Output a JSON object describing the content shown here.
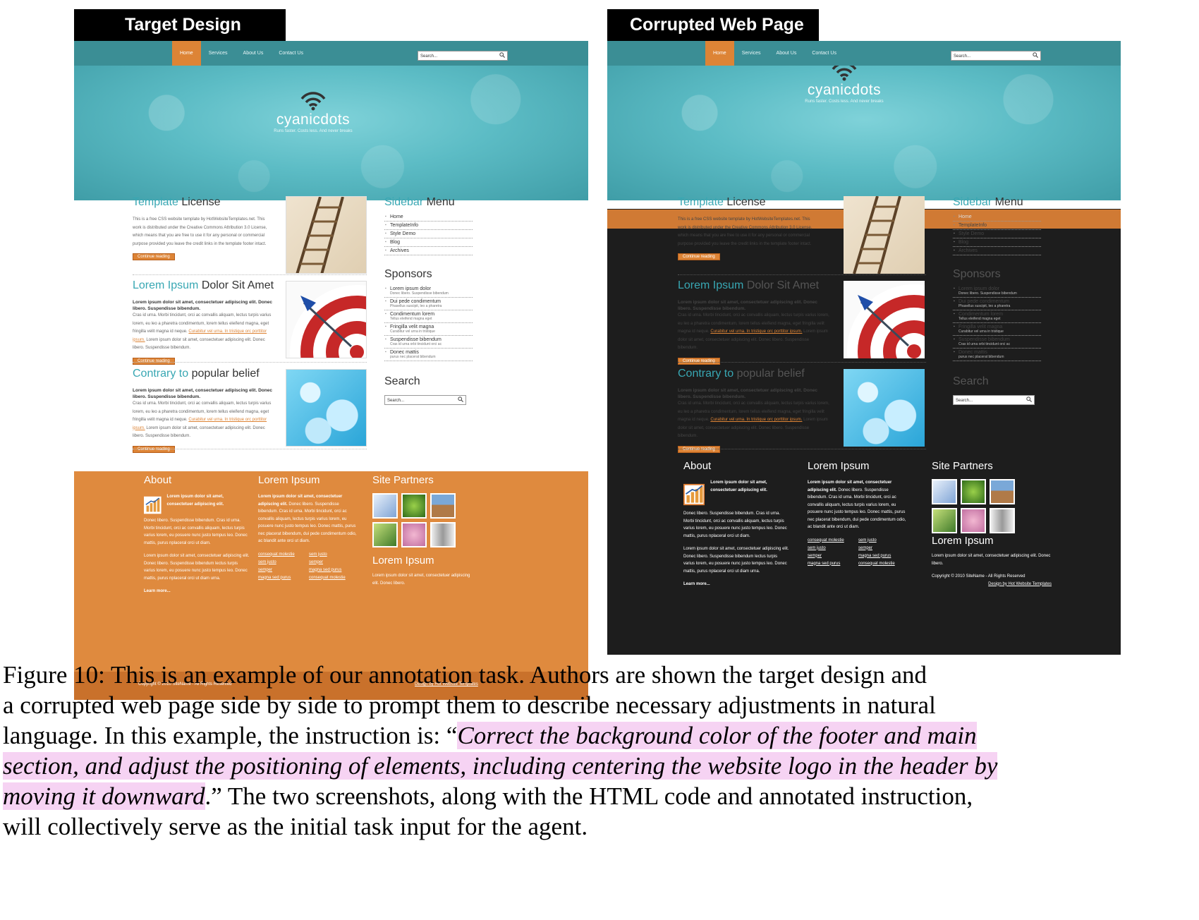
{
  "labels": {
    "left": "Target Design",
    "right": "Corrupted Web Page"
  },
  "site": {
    "nav": [
      "Home",
      "Services",
      "About Us",
      "Contact Us"
    ],
    "search_placeholder": "Search...",
    "logo_light": "cyanic",
    "logo_bold": "dots",
    "tagline": "Runs faster. Costs less. And never breaks",
    "articles": [
      {
        "accent": "Template",
        "rest": " License",
        "body": "This is a free CSS website template by HotWebsiteTemplates.net. This work is distributed under the Creative Commons Attribution 3.0 License, which means that you are free to use it for any personal or commercial purpose provided you leave the credit links in the template footer intact.",
        "button": "Continue reading"
      },
      {
        "accent": "Lorem Ipsum",
        "rest": " Dolor Sit Amet",
        "bold": "Lorem ipsum dolor sit amet, consectetuer adipiscing elit. Donec libero. Suspendisse bibendum.",
        "body": "Cras id urna. Morbi tincidunt, orci ac convallis aliquam, lectus turpis varius lorem, eu leo a pharetra condimentum, lorem tellus eleifend magna, eget fringilla velit magna id neque.",
        "link": "Curabitur vel urna. In tristique orc porttitor ipsum.",
        "body2": "Lorem ipsum dolor sit amet, consectetuer adipiscing elit. Donec libero. Suspendisse bibendum.",
        "button": "Continue reading"
      },
      {
        "accent": "Contrary to",
        "rest": " popular belief",
        "bold": "Lorem ipsum dolor sit amet, consectetuer adipiscing elit. Donec libero. Suspendisse bibendum.",
        "body": "Cras id urna. Morbi tincidunt, orci ac convallis aliquam, lectus turpis varius lorem, eu leo a pharetra condimentum, lorem tellus eleifend magna, eget fringilla velit magna id neque.",
        "link": "Curabitur vel urna. In tristique orc porttitor ipsum.",
        "body2": "Lorem ipsum dolor sit amet, consectetuer adipiscing elit. Donec libero. Suspendisse bibendum.",
        "button": "Continue reading"
      }
    ],
    "sidebar": {
      "menu_accent": "Sidebar",
      "menu_rest": " Menu",
      "menu_items": [
        "Home",
        "TemplateInfo",
        "Style Demo",
        "Blog",
        "Archives"
      ],
      "sponsors_title": "Sponsors",
      "sponsors": [
        {
          "name": "Lorem ipsum dolor",
          "sub": "Donec libero. Suspendisse bibendum"
        },
        {
          "name": "Dui pede condimentum",
          "sub": "Phasellus suscipit, leo a pharetra"
        },
        {
          "name": "Condimentum lorem",
          "sub": "Tellus eleifend magna eget"
        },
        {
          "name": "Fringilla velit magna",
          "sub": "Curabitur vel urna in tristique"
        },
        {
          "name": "Suspendisse bibendum",
          "sub": "Cras id urna orbi tincidunt orci ac"
        },
        {
          "name": "Donec mattis",
          "sub": "purus nec placerat bibendum"
        }
      ],
      "search_title": "Search"
    },
    "footer": {
      "about_title": "About",
      "about_bold": "Lorem ipsum dolor sit amet, consectetuer adipiscing elit.",
      "about_body": "Donec libero. Suspendisse bibendum. Cras id urna. Morbi tincidunt, orci ac convallis aliquam, lectus turpis varius lorem, eu posuere nunc justo tempus leo. Donec mattis, purus nplaceral orci ut diam.",
      "about_body2": "Lorem ipsum dolor sit amet, consectetuer adipiscing elit. Donec libero. Suspendisse bibendum lectus turpis varius lorem, eu posuere nunc justo tempus leo. Donec mattis, purus nplaceral orci ut diam urna.",
      "learn_more": "Learn more...",
      "lorem_title": "Lorem Ipsum",
      "lorem_bold": "Lorem ipsum dolor sit amet, consectetuer adipiscing elit.",
      "lorem_body": "Donec libero. Suspendisse bibendum. Cras id urna. Morbi tincidunt, orci ac convallis aliquam, lectus turpis varius lorem, eu posuere nunc justo tempus leo. Donec mattis, purus nec placerat bibendum, dui pede condimentum odio, ac blandit ante orci ut diam.",
      "links": [
        "consequat molestie",
        "sem justo",
        "sem justo",
        "semper",
        "semper",
        "magna sed purus",
        "magna sed purus",
        "consequat molestie"
      ],
      "partners_title": "Site Partners",
      "lorem2_title": "Lorem Ipsum",
      "lorem2_body": "Lorem ipsum dolor sit amet, consectetuer adipiscing elit. Donec libero.",
      "copyright": "Copyright © 2010 SiteName - All Rights Reserved",
      "design": "Design by Hot Website Templates"
    }
  },
  "caption": {
    "line1": "Figure 10: This is an example of our annotation task. Authors are shown the target design and",
    "line2": "a corrupted web page side by side to prompt them to describe necessary adjustments in natural",
    "line3_pre": "language. In this example, the instruction is: “",
    "highlight1": "Correct the background color of the footer and main",
    "highlight2": "section, and adjust the positioning of elements, including centering the website logo in the header by",
    "highlight3": "moving it downward",
    "line5_post": ".” The two screenshots, along with the HTML code and annotated instruction,",
    "line6": "will collectively serve as the initial task input for the agent."
  },
  "colors": {
    "accent_teal": "#38a7b3",
    "orange": "#dd8436",
    "dark_bg": "#1d1d1d",
    "highlight": "#f6d3f3"
  }
}
